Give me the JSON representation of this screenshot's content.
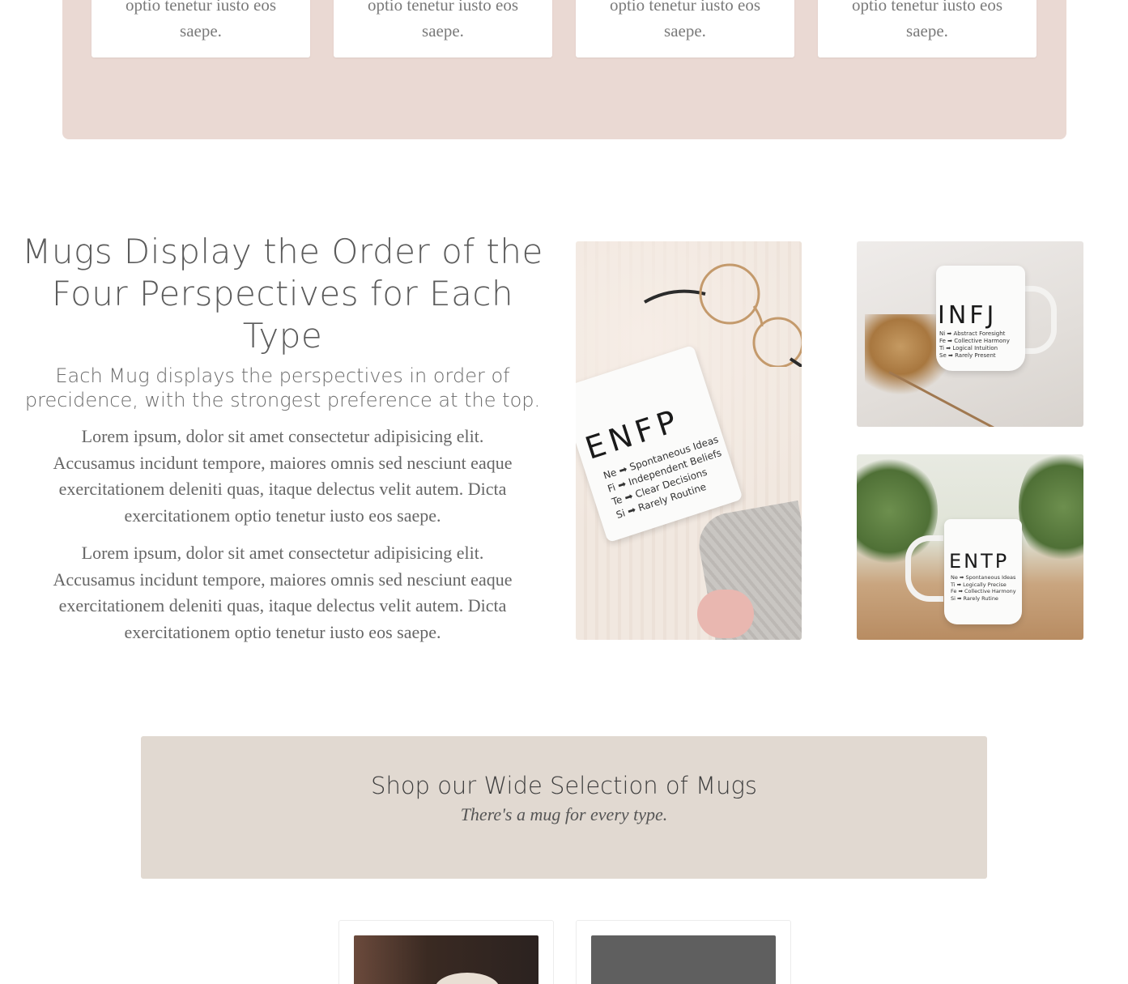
{
  "top_cards": [
    {
      "text": "optio tenetur iusto eos saepe."
    },
    {
      "text": "optio tenetur iusto eos saepe."
    },
    {
      "text": "optio tenetur iusto eos saepe."
    },
    {
      "text": "optio tenetur iusto eos saepe."
    }
  ],
  "mugs_section": {
    "heading": "Mugs Display the Order of the Four Perspectives for Each Type",
    "subheading": "Each Mug displays the perspectives in order of precidence, with the strongest preference at the top.",
    "paragraphs": [
      "Lorem ipsum, dolor sit amet consectetur adipisicing elit. Accusamus incidunt tempore, maiores omnis sed nesciunt eaque exercitationem deleniti quas, itaque delectus velit autem. Dicta exercitationem optio tenetur iusto eos saepe.",
      "Lorem ipsum, dolor sit amet consectetur adipisicing elit. Accusamus incidunt tempore, maiores omnis sed nesciunt eaque exercitationem deleniti quas, itaque delectus velit autem. Dicta exercitationem optio tenetur iusto eos saepe."
    ],
    "photos": {
      "enfp": {
        "type": "ENFP",
        "lines": "Ne ➡ Spontaneous Ideas\nFi ➡ Independent Beliefs\nTe ➡ Clear Decisions\nSi ➡ Rarely Routine"
      },
      "infj": {
        "type": "INFJ",
        "lines": "Ni ➡ Abstract Foresight\nFe ➡ Collective Harmony\nTi ➡ Logical Intuition\nSe ➡ Rarely Present"
      },
      "entp": {
        "type": "ENTP",
        "lines": "Ne ➡ Spontaneous Ideas\nTi ➡ Logically Precise\nFe ➡ Collective Harmony\nSi ➡ Rarely Rutine"
      }
    }
  },
  "shop_banner": {
    "title": "Shop our Wide Selection of Mugs",
    "tagline": "There's a mug for every type."
  },
  "colors": {
    "pink_band": "#ead9d3",
    "shop_banner": "#e1d9d1",
    "text": "#555555"
  }
}
